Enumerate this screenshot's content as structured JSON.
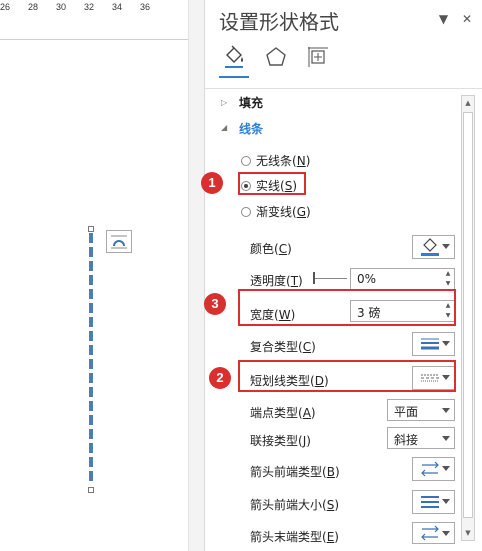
{
  "ruler": {
    "ticks": [
      "26",
      "28",
      "30",
      "32",
      "34",
      "36"
    ]
  },
  "panel": {
    "title": "设置形状格式",
    "pin_icon": "dropdown-arrow",
    "close_icon": "close",
    "tabs": [
      "fill-line-icon",
      "effects-pentagon-icon",
      "layout-properties-icon"
    ],
    "fill_section": "填充",
    "line_section": "线条",
    "radio_options": [
      {
        "label": "无线条",
        "key": "N",
        "selected": false
      },
      {
        "label": "实线",
        "key": "S",
        "selected": true
      },
      {
        "label": "渐变线",
        "key": "G",
        "selected": false
      }
    ],
    "color_label": "颜色",
    "color_key": "C",
    "transparency_label": "透明度",
    "transparency_key": "T",
    "transparency_value": "0%",
    "width_label": "宽度",
    "width_key": "W",
    "width_value": "3 磅",
    "compound_label": "复合类型",
    "compound_key": "C",
    "dash_label": "短划线类型",
    "dash_key": "D",
    "cap_label": "端点类型",
    "cap_key": "A",
    "cap_value": "平面",
    "join_label": "联接类型",
    "join_key": "J",
    "join_value": "斜接",
    "begin_arrow_type_label": "箭头前端类型",
    "begin_arrow_type_key": "B",
    "begin_arrow_size_label": "箭头前端大小",
    "begin_arrow_size_key": "S",
    "end_arrow_type_label": "箭头末端类型",
    "end_arrow_type_key": "E"
  },
  "callouts": [
    "1",
    "2",
    "3"
  ],
  "colors": {
    "accent": "#2c7fd1",
    "annotation": "#d9302f",
    "line_shape": "#4a7fb5"
  }
}
